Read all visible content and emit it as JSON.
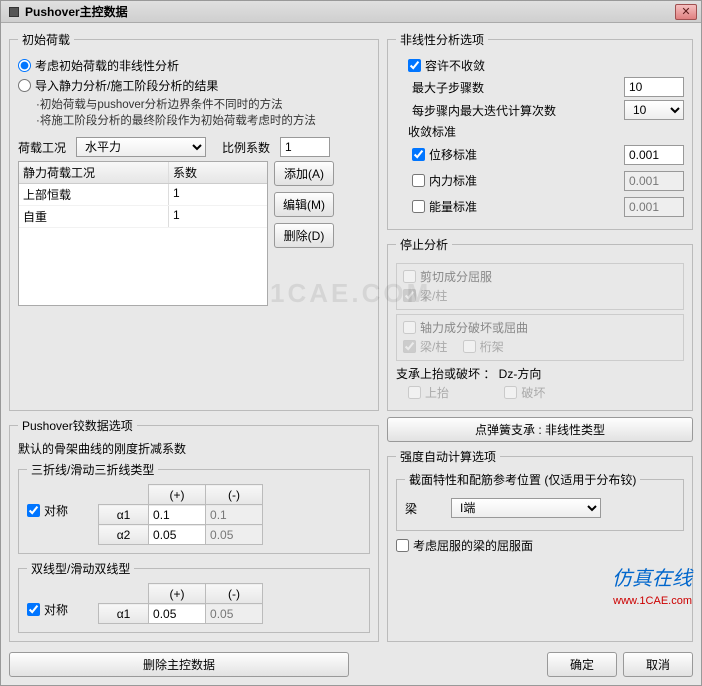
{
  "window": {
    "title": "Pushover主控数据",
    "close_tooltip": "关闭"
  },
  "initial_load": {
    "legend": "初始荷载",
    "radio1": "考虑初始荷载的非线性分析",
    "radio2": "导入静力分析/施工阶段分析的结果",
    "note1": "·初始荷载与pushover分析边界条件不同时的方法",
    "note2": "·将施工阶段分析的最终阶段作为初始荷载考虑时的方法",
    "load_case_label": "荷载工况",
    "load_case_value": "水平力",
    "scale_label": "比例系数",
    "scale_value": "1",
    "table_header1": "静力荷载工况",
    "table_header2": "系数",
    "table_rows": [
      {
        "name": "上部恒载",
        "coef": "1"
      },
      {
        "name": "自重",
        "coef": "1"
      }
    ],
    "btn_add": "添加(A)",
    "btn_edit": "编辑(M)",
    "btn_delete": "删除(D)"
  },
  "nonlinear": {
    "legend": "非线性分析选项",
    "allow_nonconv": "容许不收敛",
    "max_substeps_label": "最大子步骤数",
    "max_substeps_value": "10",
    "max_iter_label": "每步骤内最大迭代计算次数",
    "max_iter_value": "10",
    "conv_legend": "收敛标准",
    "disp_label": "位移标准",
    "disp_value": "0.001",
    "force_label": "内力标准",
    "force_value": "0.001",
    "energy_label": "能量标准",
    "energy_value": "0.001"
  },
  "stop": {
    "legend": "停止分析",
    "shear_yield": "剪切成分屈服",
    "beam_col": "梁/柱",
    "axial_fail": "轴力成分破坏或屈曲",
    "truss": "桁架",
    "support_row": "支承上抬或破坏 ： Dz-方向",
    "uplift": "上抬",
    "collapse": "破坏"
  },
  "hinge": {
    "legend": "Pushover铰数据选项",
    "default_label": "默认的骨架曲线的刚度折减系数",
    "tri_legend": "三折线/滑动三折线类型",
    "symmetrical": "对称",
    "col_plus": "(+)",
    "col_minus": "(-)",
    "a1_label": "α1",
    "a1_p": "0.1",
    "a1_m": "0.1",
    "a2_label": "α2",
    "a2_p": "0.05",
    "a2_m": "0.05",
    "bi_legend": "双线型/滑动双线型",
    "b_a1_p": "0.05",
    "b_a1_m": "0.05"
  },
  "spring": {
    "btn": "点弹簧支承 : 非线性类型"
  },
  "strength": {
    "legend": "强度自动计算选项",
    "section_label": "截面特性和配筋参考位置 (仅适用于分布铰)",
    "beam_label": "梁",
    "beam_value": "I端",
    "consider_yield": "考虑屈服的梁的屈服面"
  },
  "footer": {
    "delete_main": "删除主控数据",
    "ok": "确定",
    "cancel": "取消"
  },
  "watermarks": {
    "w1": "1CAE.COM",
    "w2": "仿真在线",
    "w3": "www.1CAE.com"
  }
}
